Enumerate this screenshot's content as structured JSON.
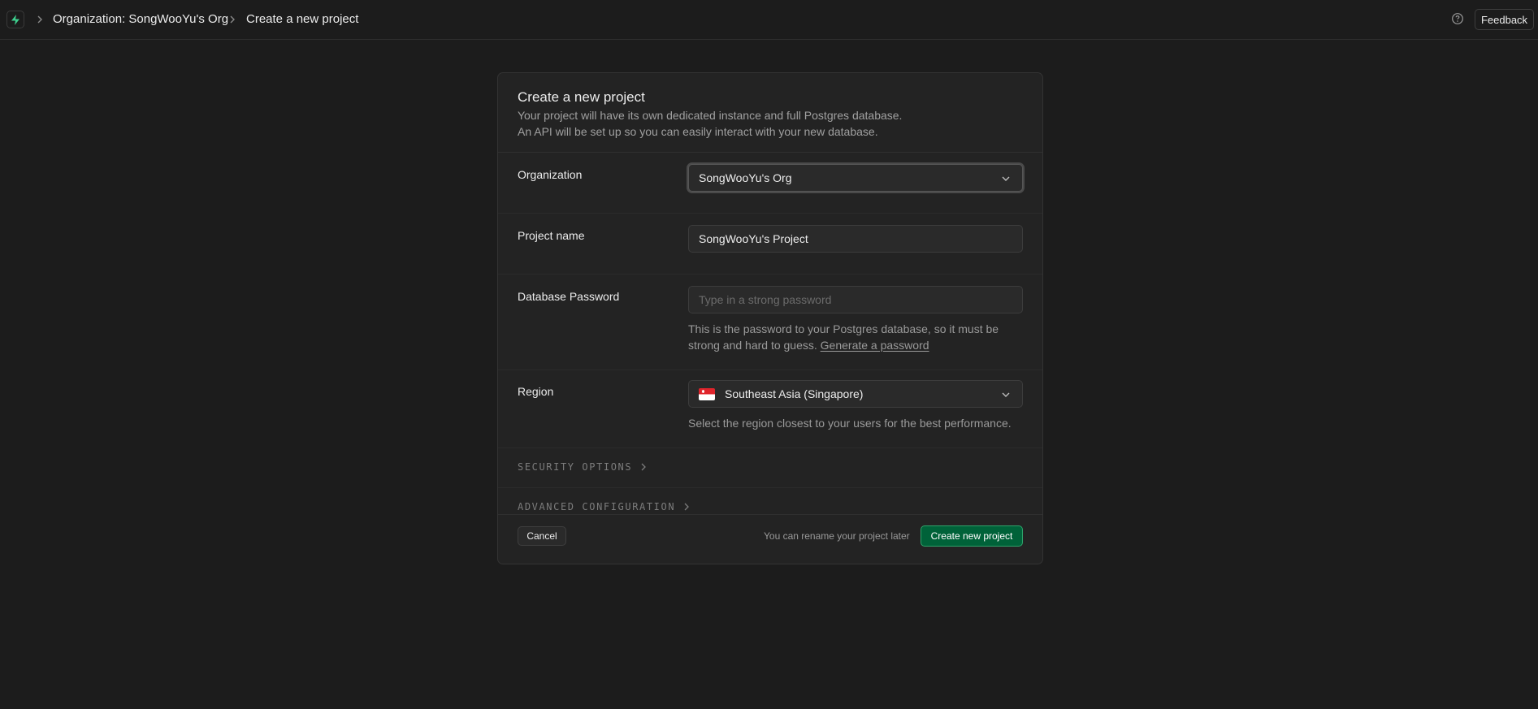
{
  "breadcrumb": {
    "logo_icon": "supabase-bolt-icon",
    "organization": "Organization: SongWooYu's Org",
    "page": "Create a new project"
  },
  "topbar": {
    "help_icon": "help-circle-icon",
    "feedback_label": "Feedback"
  },
  "form": {
    "title": "Create a new project",
    "description_line1": "Your project will have its own dedicated instance and full Postgres database.",
    "description_line2": "An API will be set up so you can easily interact with your new database.",
    "organization": {
      "label": "Organization",
      "value": "SongWooYu's Org"
    },
    "project_name": {
      "label": "Project name",
      "value": "SongWooYu's Project"
    },
    "database_password": {
      "label": "Database Password",
      "placeholder": "Type in a strong password",
      "helper_line1": "This is the password to your Postgres database, so it must be",
      "helper_line2": "strong and hard to guess.",
      "generate_link": "Generate a password"
    },
    "region": {
      "label": "Region",
      "value": "Southeast Asia (Singapore)",
      "flag": "singapore-flag-icon",
      "helper": "Select the region closest to your users for the best performance."
    },
    "security_options_label": "SECURITY OPTIONS",
    "advanced_configuration_label": "ADVANCED CONFIGURATION"
  },
  "footer": {
    "cancel_label": "Cancel",
    "rename_note": "You can rename your project later",
    "create_label": "Create new project"
  },
  "colors": {
    "background": "#1c1c1c",
    "card": "#232323",
    "brand_green": "#3ecf8e",
    "primary_button": "#006239"
  }
}
